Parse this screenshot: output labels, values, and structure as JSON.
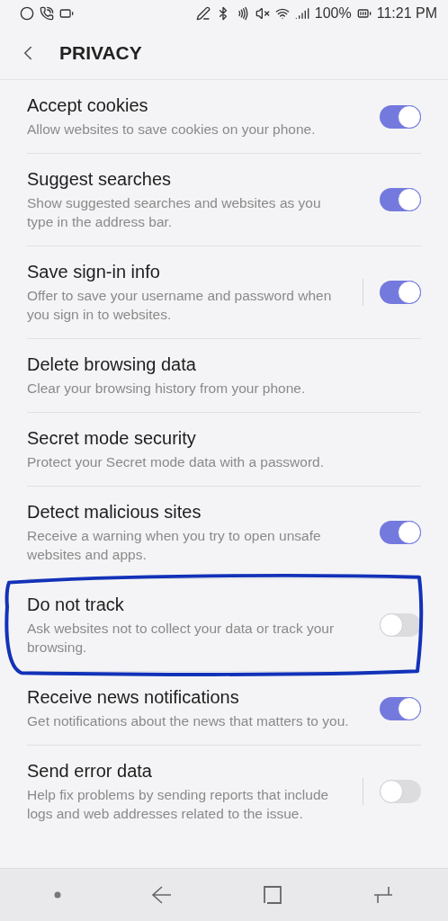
{
  "status_bar": {
    "battery": "100%",
    "time": "11:21 PM"
  },
  "header": {
    "title": "PRIVACY"
  },
  "settings": [
    {
      "title": "Accept cookies",
      "subtitle": "Allow websites to save cookies on your phone.",
      "kind": "toggle",
      "on": true,
      "divider": false
    },
    {
      "title": "Suggest searches",
      "subtitle": "Show suggested searches and websites as you type in the address bar.",
      "kind": "toggle",
      "on": true,
      "divider": false
    },
    {
      "title": "Save sign-in info",
      "subtitle": "Offer to save your username and password when you sign in to websites.",
      "kind": "toggle",
      "on": true,
      "divider": true
    },
    {
      "title": "Delete browsing data",
      "subtitle": "Clear your browsing history from your phone.",
      "kind": "link"
    },
    {
      "title": "Secret mode security",
      "subtitle": "Protect your Secret mode data with a password.",
      "kind": "link"
    },
    {
      "title": "Detect malicious sites",
      "subtitle": "Receive a warning when you try to open unsafe websites and apps.",
      "kind": "toggle",
      "on": true,
      "divider": false
    },
    {
      "title": "Do not track",
      "subtitle": "Ask websites not to collect your data or track your browsing.",
      "kind": "toggle",
      "on": false,
      "divider": false,
      "annotated": true
    },
    {
      "title": "Receive news notifications",
      "subtitle": "Get notifications about the news that matters to you.",
      "kind": "toggle",
      "on": true,
      "divider": false
    },
    {
      "title": "Send error data",
      "subtitle": "Help fix problems by sending reports that include logs and web addresses related to the issue.",
      "kind": "toggle",
      "on": false,
      "divider": true
    }
  ]
}
